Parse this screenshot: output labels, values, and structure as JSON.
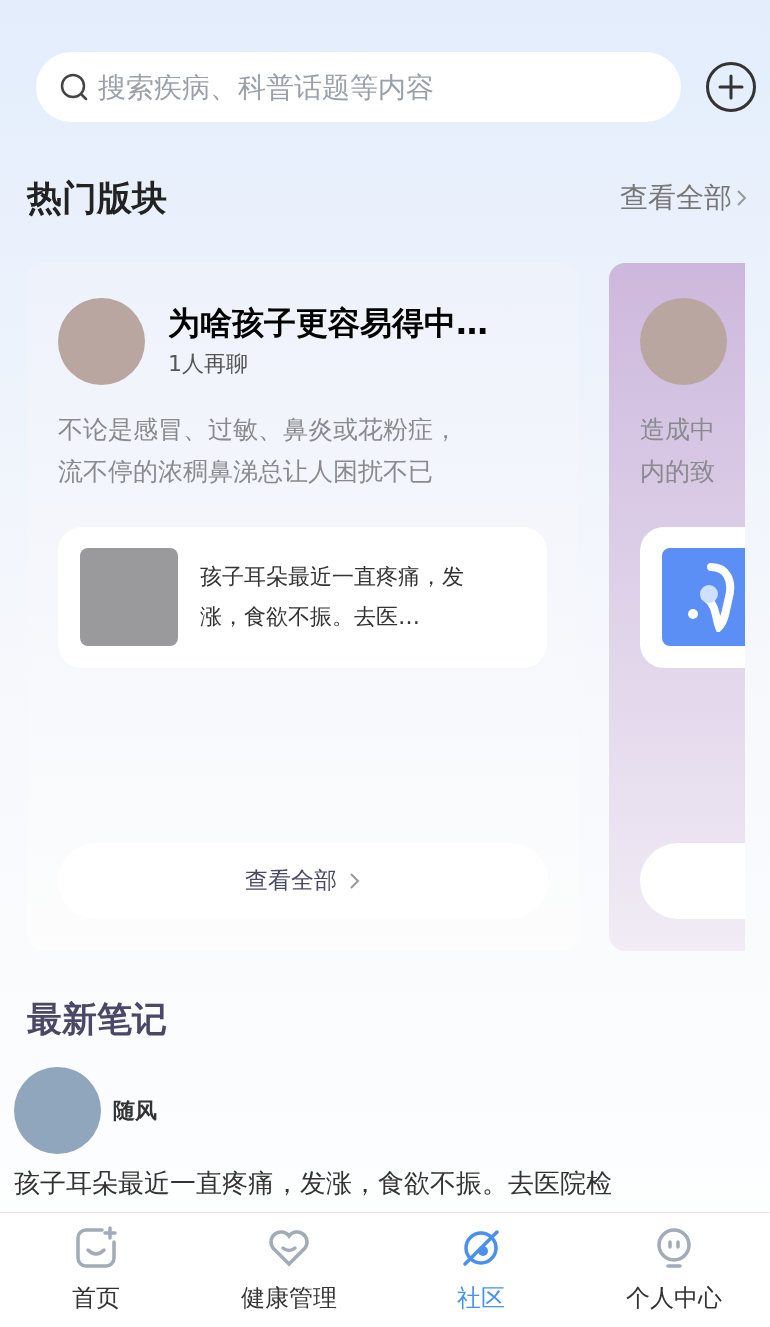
{
  "search": {
    "placeholder": "搜索疾病、科普话题等内容"
  },
  "hot_section": {
    "title": "热门版块",
    "view_all": "查看全部"
  },
  "boards": [
    {
      "kind": "full",
      "title": "为啥孩子更容易得中…",
      "participants": "1人再聊",
      "description_lines": [
        "不论是感冒、过敏、鼻炎或花粉症，",
        "流不停的浓稠鼻涕总让人困扰不已"
      ],
      "post": {
        "kind": "photo",
        "text": "孩子耳朵最近一直疼痛，发涨，食欲不振。去医…"
      },
      "button": "查看全部"
    },
    {
      "kind": "partial",
      "description_lines": [
        "造成中",
        "内的致"
      ],
      "post": {
        "kind": "ear-logo"
      }
    }
  ],
  "notes_section": {
    "title": "最新笔记"
  },
  "notes": [
    {
      "author": "随风",
      "text": "孩子耳朵最近一直疼痛，发涨，食欲不振。去医院检"
    }
  ],
  "tabs": [
    {
      "kind": "home",
      "label": "首页",
      "selected": false
    },
    {
      "kind": "health",
      "label": "健康管理",
      "selected": false
    },
    {
      "kind": "community",
      "label": "社区",
      "selected": true
    },
    {
      "kind": "profile",
      "label": "个人中心",
      "selected": false
    }
  ]
}
